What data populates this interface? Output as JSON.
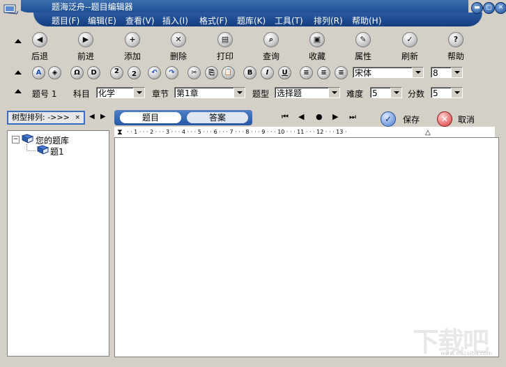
{
  "window": {
    "title": "题海泛舟--题目编辑器",
    "menu": [
      "题目(F)",
      "编辑(E)",
      "查看(V)",
      "插入(I)",
      "格式(F)",
      "题库(K)",
      "工具(T)",
      "排列(R)",
      "帮助(H)"
    ]
  },
  "toolbar": {
    "buttons": [
      {
        "label": "后退",
        "icon": "back-arrow-icon"
      },
      {
        "label": "前进",
        "icon": "forward-arrow-icon"
      },
      {
        "label": "添加",
        "icon": "plus-icon"
      },
      {
        "label": "删除",
        "icon": "delete-x-icon"
      },
      {
        "label": "打印",
        "icon": "printer-icon"
      },
      {
        "label": "查询",
        "icon": "magnifier-icon"
      },
      {
        "label": "收藏",
        "icon": "favorites-icon"
      },
      {
        "label": "属性",
        "icon": "properties-icon"
      },
      {
        "label": "刷新",
        "icon": "checkmark-icon"
      },
      {
        "label": "帮助",
        "icon": "question-icon"
      }
    ]
  },
  "format": {
    "font": "宋体",
    "size": "8",
    "glyphs": [
      "A",
      "◈",
      "Ω",
      "D",
      "2",
      "2",
      "↶",
      "↷",
      "✂",
      "⎘",
      "📋",
      "B",
      "I",
      "U",
      "≡",
      "≡",
      "≡"
    ]
  },
  "question": {
    "number_label": "题号 1",
    "subject_label": "科目",
    "subject": "化学",
    "chapter_label": "章节",
    "chapter": "第1章",
    "type_label": "题型",
    "type": "选择题",
    "difficulty_label": "难度",
    "difficulty": "5",
    "score_label": "分数",
    "score": "5"
  },
  "tree": {
    "sort_label": "树型排列: ->>>",
    "root": "您的题库",
    "child": "题1"
  },
  "tabs": {
    "question": "题目",
    "answer": "答案"
  },
  "actions": {
    "save": "保存",
    "cancel": "取消"
  },
  "ruler": "· · 1 · · · 2 · · · 3 · · · 4 · · · 5 · · · 6 · · · 7 · · · 8 · · · 9 · · · 10 · · · 11 · · · 12 · · · 13 ·",
  "watermark": {
    "text": "下载吧",
    "url": "www.xiazaiba.com"
  }
}
